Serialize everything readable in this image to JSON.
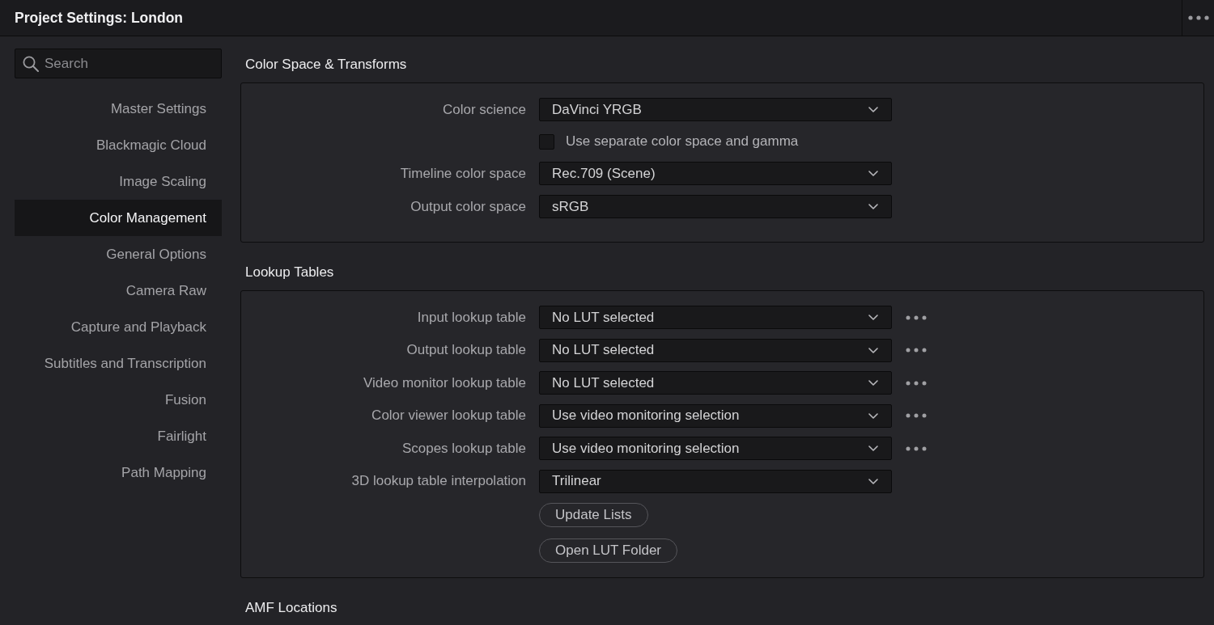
{
  "window": {
    "title": "Project Settings: London"
  },
  "sidebar": {
    "search": {
      "placeholder": "Search"
    },
    "items": [
      {
        "label": "Master Settings",
        "selected": false
      },
      {
        "label": "Blackmagic Cloud",
        "selected": false
      },
      {
        "label": "Image Scaling",
        "selected": false
      },
      {
        "label": "Color Management",
        "selected": true
      },
      {
        "label": "General Options",
        "selected": false
      },
      {
        "label": "Camera Raw",
        "selected": false
      },
      {
        "label": "Capture and Playback",
        "selected": false
      },
      {
        "label": "Subtitles and Transcription",
        "selected": false
      },
      {
        "label": "Fusion",
        "selected": false
      },
      {
        "label": "Fairlight",
        "selected": false
      },
      {
        "label": "Path Mapping",
        "selected": false
      }
    ]
  },
  "sections": [
    {
      "heading": "Color Space & Transforms",
      "rows": [
        {
          "kind": "dropdown",
          "label": "Color science",
          "value": "DaVinci YRGB",
          "more": false
        },
        {
          "kind": "checkbox",
          "label": "Use separate color space and gamma",
          "checked": false
        },
        {
          "kind": "dropdown",
          "label": "Timeline color space",
          "value": "Rec.709 (Scene)",
          "more": false
        },
        {
          "kind": "dropdown",
          "label": "Output color space",
          "value": "sRGB",
          "more": false
        }
      ]
    },
    {
      "heading": "Lookup Tables",
      "rows": [
        {
          "kind": "dropdown",
          "label": "Input lookup table",
          "value": "No LUT selected",
          "more": true
        },
        {
          "kind": "dropdown",
          "label": "Output lookup table",
          "value": "No LUT selected",
          "more": true
        },
        {
          "kind": "dropdown",
          "label": "Video monitor lookup table",
          "value": "No LUT selected",
          "more": true
        },
        {
          "kind": "dropdown",
          "label": "Color viewer lookup table",
          "value": "Use video monitoring selection",
          "more": true
        },
        {
          "kind": "dropdown",
          "label": "Scopes lookup table",
          "value": "Use video monitoring selection",
          "more": true
        },
        {
          "kind": "dropdown",
          "label": "3D lookup table interpolation",
          "value": "Trilinear",
          "more": false
        },
        {
          "kind": "button",
          "label": "Update Lists"
        },
        {
          "kind": "button",
          "label": "Open LUT Folder"
        }
      ]
    },
    {
      "heading": "AMF Locations"
    }
  ]
}
